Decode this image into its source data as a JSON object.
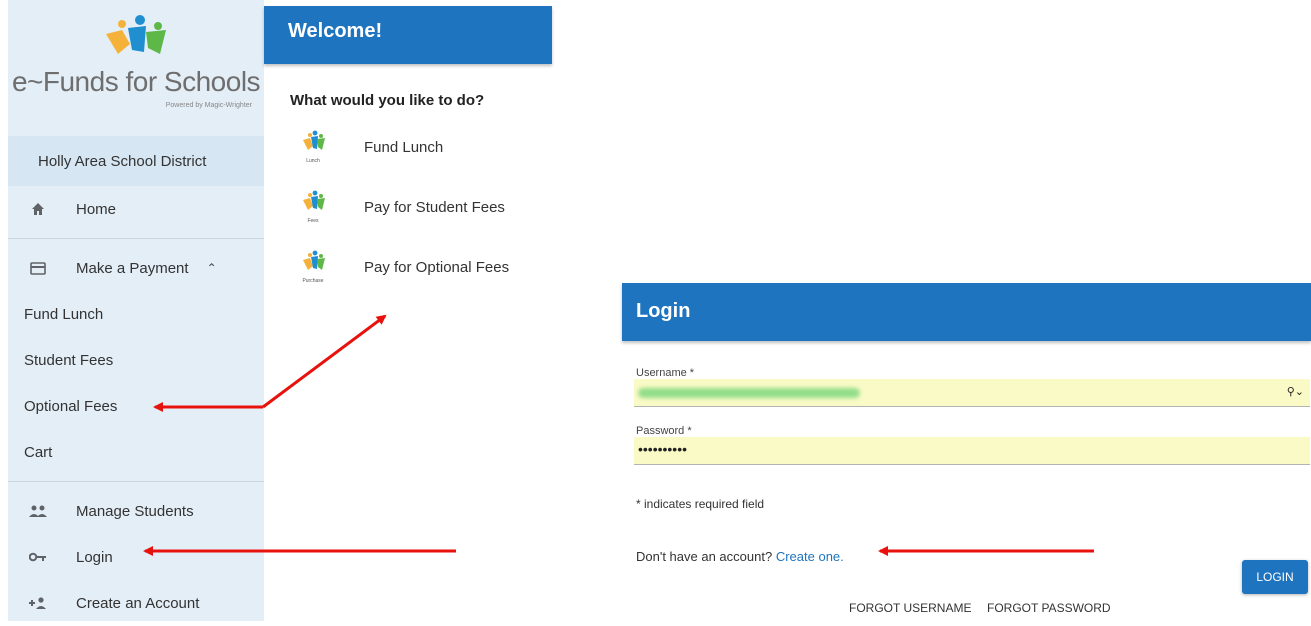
{
  "sidebar": {
    "brand": "e~Funds for Schools",
    "powered": "Powered by Magic-Wrighter",
    "district": "Holly Area School District",
    "items": [
      {
        "label": "Home"
      },
      {
        "label": "Make a Payment"
      },
      {
        "label": "Fund Lunch"
      },
      {
        "label": "Student Fees"
      },
      {
        "label": "Optional Fees"
      },
      {
        "label": "Cart"
      },
      {
        "label": "Manage Students"
      },
      {
        "label": "Login"
      },
      {
        "label": "Create an Account"
      }
    ]
  },
  "welcome": {
    "title": "Welcome!",
    "question": "What would you like to do?",
    "options": [
      {
        "label": "Fund Lunch",
        "caption": "Lunch"
      },
      {
        "label": "Pay for Student Fees",
        "caption": "Fees"
      },
      {
        "label": "Pay for Optional Fees",
        "caption": "Purchase"
      }
    ]
  },
  "login": {
    "title": "Login",
    "username_label": "Username *",
    "password_label": "Password *",
    "password_value": "••••••••••",
    "required_note": "* indicates required field",
    "no_account": "Don't have an account?",
    "create_link": "Create one.",
    "login_button": "LOGIN",
    "forgot_username": "FORGOT USERNAME",
    "forgot_password": "FORGOT PASSWORD"
  },
  "colors": {
    "primary": "#1f74bf",
    "sidebar_bg": "#e4eef7",
    "autofill": "#fafac6",
    "arrow": "#e8120c"
  },
  "icons": {
    "home": "home-icon",
    "payment": "credit-card-icon",
    "students": "people-icon",
    "login": "key-icon",
    "create": "person-add-icon"
  }
}
